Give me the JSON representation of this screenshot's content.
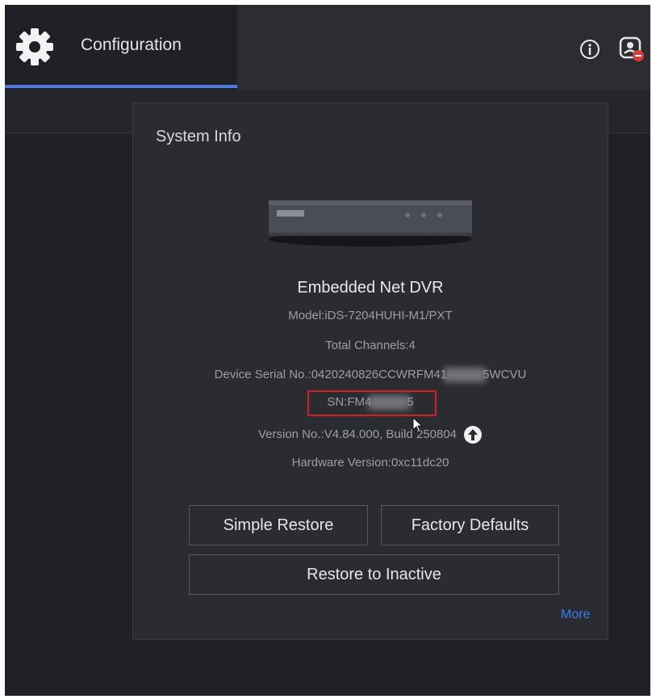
{
  "header": {
    "active_tab_label": "Configuration",
    "icons": [
      "gear-icon",
      "info-icon",
      "account-icon"
    ],
    "accent_color": "#4a7be0"
  },
  "dialog": {
    "title": "System Info",
    "device_name": "Embedded Net DVR",
    "model": "Model:iDS-7204HUHI-M1/PXT",
    "total_channels": "Total Channels:4",
    "serial_prefix": "Device Serial No.:0420240826CCWRFM41",
    "serial_suffix": "5WCVU",
    "sn_prefix": "SN:FM4",
    "sn_suffix": "5",
    "version": "Version No.:V4.84.000, Build 250804",
    "hardware_version": "Hardware Version:0xc11dc20",
    "buttons": {
      "simple_restore": "Simple Restore",
      "factory_defaults": "Factory Defaults",
      "restore_inactive": "Restore to Inactive"
    },
    "more_link": "More",
    "highlight_color": "#d42020",
    "link_color": "#3d7ef0"
  }
}
